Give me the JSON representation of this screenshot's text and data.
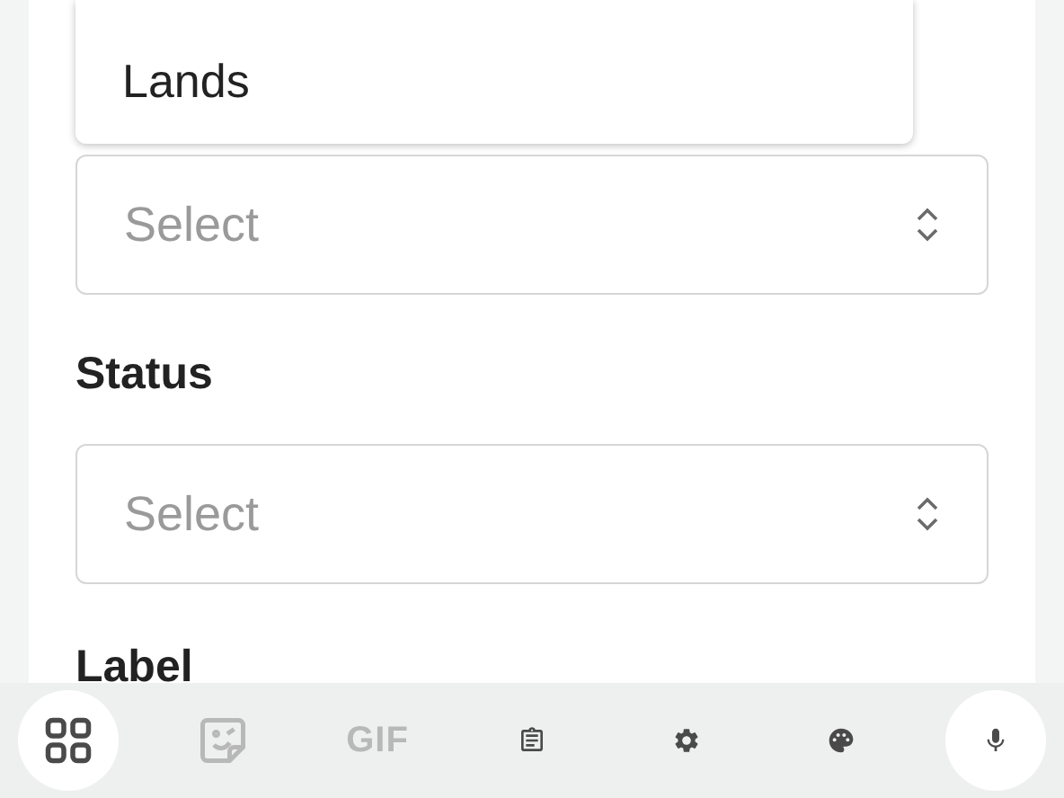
{
  "dropdown_menu": {
    "options": [
      {
        "label": "Lands"
      }
    ]
  },
  "fields": [
    {
      "placeholder": "Select"
    },
    {
      "label": "Status",
      "placeholder": "Select"
    }
  ],
  "next_label": "Label",
  "keyboard_toolbar": [
    {
      "kind": "icon",
      "disabled": false,
      "highlighted": true
    },
    {
      "kind": "icon",
      "disabled": true,
      "highlighted": false
    },
    {
      "kind": "text",
      "text": "GIF",
      "disabled": true,
      "highlighted": false
    },
    {
      "kind": "icon",
      "disabled": false,
      "highlighted": false
    },
    {
      "kind": "icon",
      "disabled": false,
      "highlighted": false
    },
    {
      "kind": "icon",
      "disabled": false,
      "highlighted": false
    },
    {
      "kind": "icon",
      "disabled": false,
      "highlighted": true
    }
  ]
}
